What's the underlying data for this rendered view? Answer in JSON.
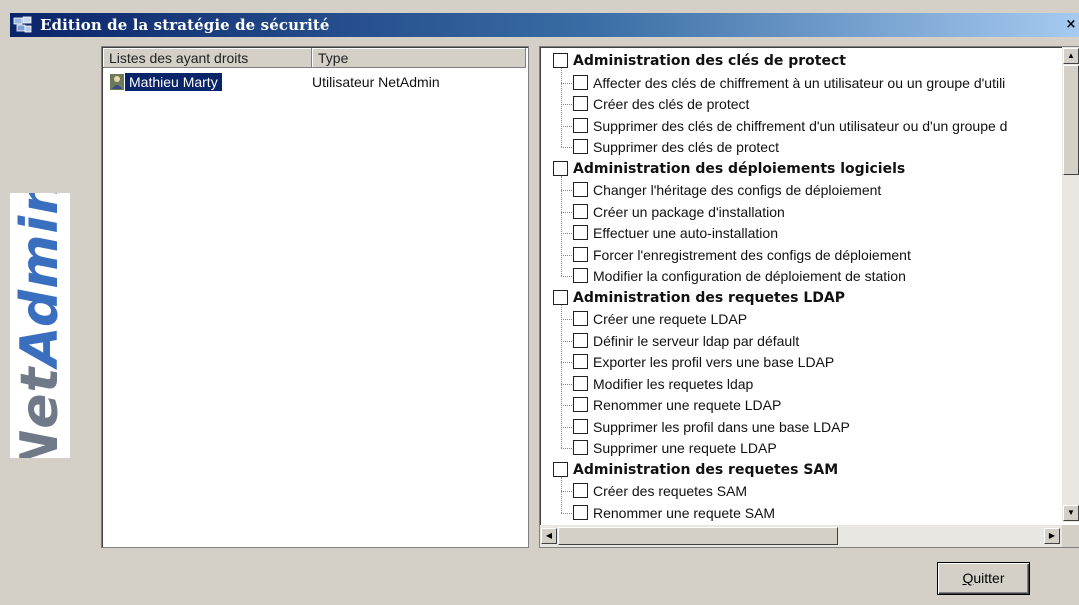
{
  "window": {
    "title": "Edition de la stratégie de sécurité",
    "close_glyph": "×",
    "title_gradient": [
      "#0a246a",
      "#a6caf0"
    ]
  },
  "logo": {
    "text_net": "Net",
    "text_admin": "Admin",
    "colors": {
      "net": "#6f7988",
      "admin": "#3a6fc0"
    }
  },
  "rights_list": {
    "columns": [
      "Listes des ayant droits",
      "Type"
    ],
    "rows": [
      {
        "name": "Mathieu Marty",
        "type": "Utilisateur NetAdmin",
        "selected": true,
        "icon": "user-icon"
      }
    ]
  },
  "permissions": {
    "groups": [
      {
        "label": "Administration des clés de protect",
        "checked": false,
        "items": [
          "Affecter des clés de chiffrement à un utilisateur ou un groupe d'utili",
          "Créer des clés de protect",
          "Supprimer des clés de chiffrement d'un utilisateur ou d'un groupe d",
          "Supprimer des clés de protect"
        ]
      },
      {
        "label": "Administration des déploiements logiciels",
        "checked": false,
        "items": [
          "Changer l'héritage des configs de déploiement",
          "Créer un package d'installation",
          "Effectuer une auto-installation",
          "Forcer l'enregistrement des configs de déploiement",
          "Modifier la configuration de déploiement de station"
        ]
      },
      {
        "label": "Administration des requetes LDAP",
        "checked": false,
        "items": [
          "Créer une requete LDAP",
          "Définir le serveur ldap par défault",
          "Exporter les profil vers une base LDAP",
          "Modifier les requetes ldap",
          "Renommer une requete LDAP",
          "Supprimer les profil dans une base LDAP",
          "Supprimer une requete LDAP"
        ]
      },
      {
        "label": "Administration des requetes SAM",
        "checked": false,
        "items": [
          "Créer des requetes SAM",
          "Renommer une requete SAM"
        ]
      }
    ],
    "scrollbars": {
      "vertical_position": 0.0,
      "horizontal_position": 0.0
    }
  },
  "buttons": {
    "quit": {
      "first_letter": "Q",
      "rest": "uitter"
    }
  }
}
